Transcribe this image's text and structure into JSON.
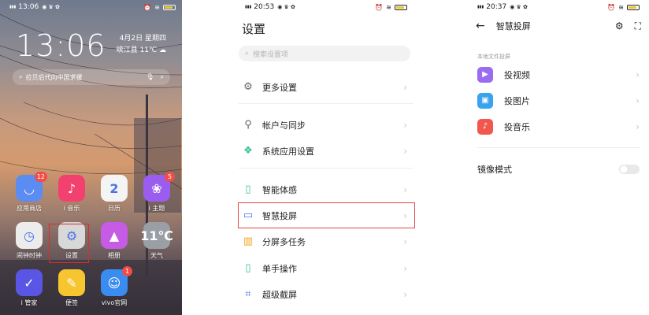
{
  "panel1": {
    "status": {
      "signal": "4G+HD\n4G+HD",
      "time": "13:06",
      "battery_color": "#e9c638"
    },
    "clock": "13:06",
    "date": "4月2日 星期四",
    "weather": "峡江县 11℃",
    "search_text": "拉贝后代向中国求援",
    "apps": [
      {
        "label": "应用商店",
        "badge": "12",
        "color": "#5b8cf2",
        "glyph": "◡"
      },
      {
        "label": "i 音乐",
        "badge": "",
        "color": "#f2416e",
        "glyph": "♪"
      },
      {
        "label": "日历",
        "badge": "",
        "color": "#f4f4f4",
        "glyph": "2"
      },
      {
        "label": "i 主题",
        "badge": "5",
        "color": "#9b5df0",
        "glyph": "❀"
      },
      {
        "label": "闹钟时钟",
        "badge": "",
        "color": "#ececec",
        "glyph": "◷"
      },
      {
        "label": "设置",
        "badge": "",
        "color": "#d8d8d8",
        "glyph": "⚙"
      },
      {
        "label": "相册",
        "badge": "",
        "color": "#c65be6",
        "glyph": "▲"
      },
      {
        "label": "天气",
        "badge": "",
        "color": "#9a9fa6",
        "glyph": "11℃"
      },
      {
        "label": "i 管家",
        "badge": "",
        "color": "#5b55e6",
        "glyph": "✓"
      },
      {
        "label": "便签",
        "badge": "",
        "color": "#f6c530",
        "glyph": "✎"
      },
      {
        "label": "vivo官网",
        "badge": "1",
        "color": "#3a8cf0",
        "glyph": "☺"
      },
      {
        "label": "",
        "badge": "",
        "color": "transparent",
        "glyph": ""
      }
    ]
  },
  "panel2": {
    "status": {
      "signal": "4G+HD\n4G+HD",
      "time": "20:53",
      "battery_color": "#e9c638"
    },
    "title": "设置",
    "search_placeholder": "搜索设置项",
    "items": [
      {
        "label": "更多设置",
        "icon": "gear-icon",
        "color": "#666666"
      },
      {
        "label": "帐户与同步",
        "icon": "key-icon",
        "color": "#666666"
      },
      {
        "label": "系统应用设置",
        "icon": "grid-icon",
        "color": "#2fc28b"
      },
      {
        "label": "智能体感",
        "icon": "phone-icon",
        "color": "#2fc28b"
      },
      {
        "label": "智慧投屏",
        "icon": "cast-icon",
        "color": "#4a73e8"
      },
      {
        "label": "分屏多任务",
        "icon": "split-icon",
        "color": "#f6a623"
      },
      {
        "label": "单手操作",
        "icon": "hand-phone-icon",
        "color": "#2fc28b"
      },
      {
        "label": "超级截屏",
        "icon": "crop-icon",
        "color": "#4a73e8"
      }
    ]
  },
  "panel3": {
    "status": {
      "signal": "4G+HD\n4G+HD",
      "time": "20:37",
      "battery_color": "#e9c638"
    },
    "title": "智慧投屏",
    "section_label": "本地文件投屏",
    "items": [
      {
        "label": "投视频",
        "icon": "play-icon",
        "color": "#9a6cf2",
        "glyph": "▶"
      },
      {
        "label": "投图片",
        "icon": "image-icon",
        "color": "#3aa3f0",
        "glyph": "▣"
      },
      {
        "label": "投音乐",
        "icon": "music-icon",
        "color": "#f2574e",
        "glyph": "♪"
      }
    ],
    "mirror_label": "镜像模式",
    "mirror_on": false
  }
}
